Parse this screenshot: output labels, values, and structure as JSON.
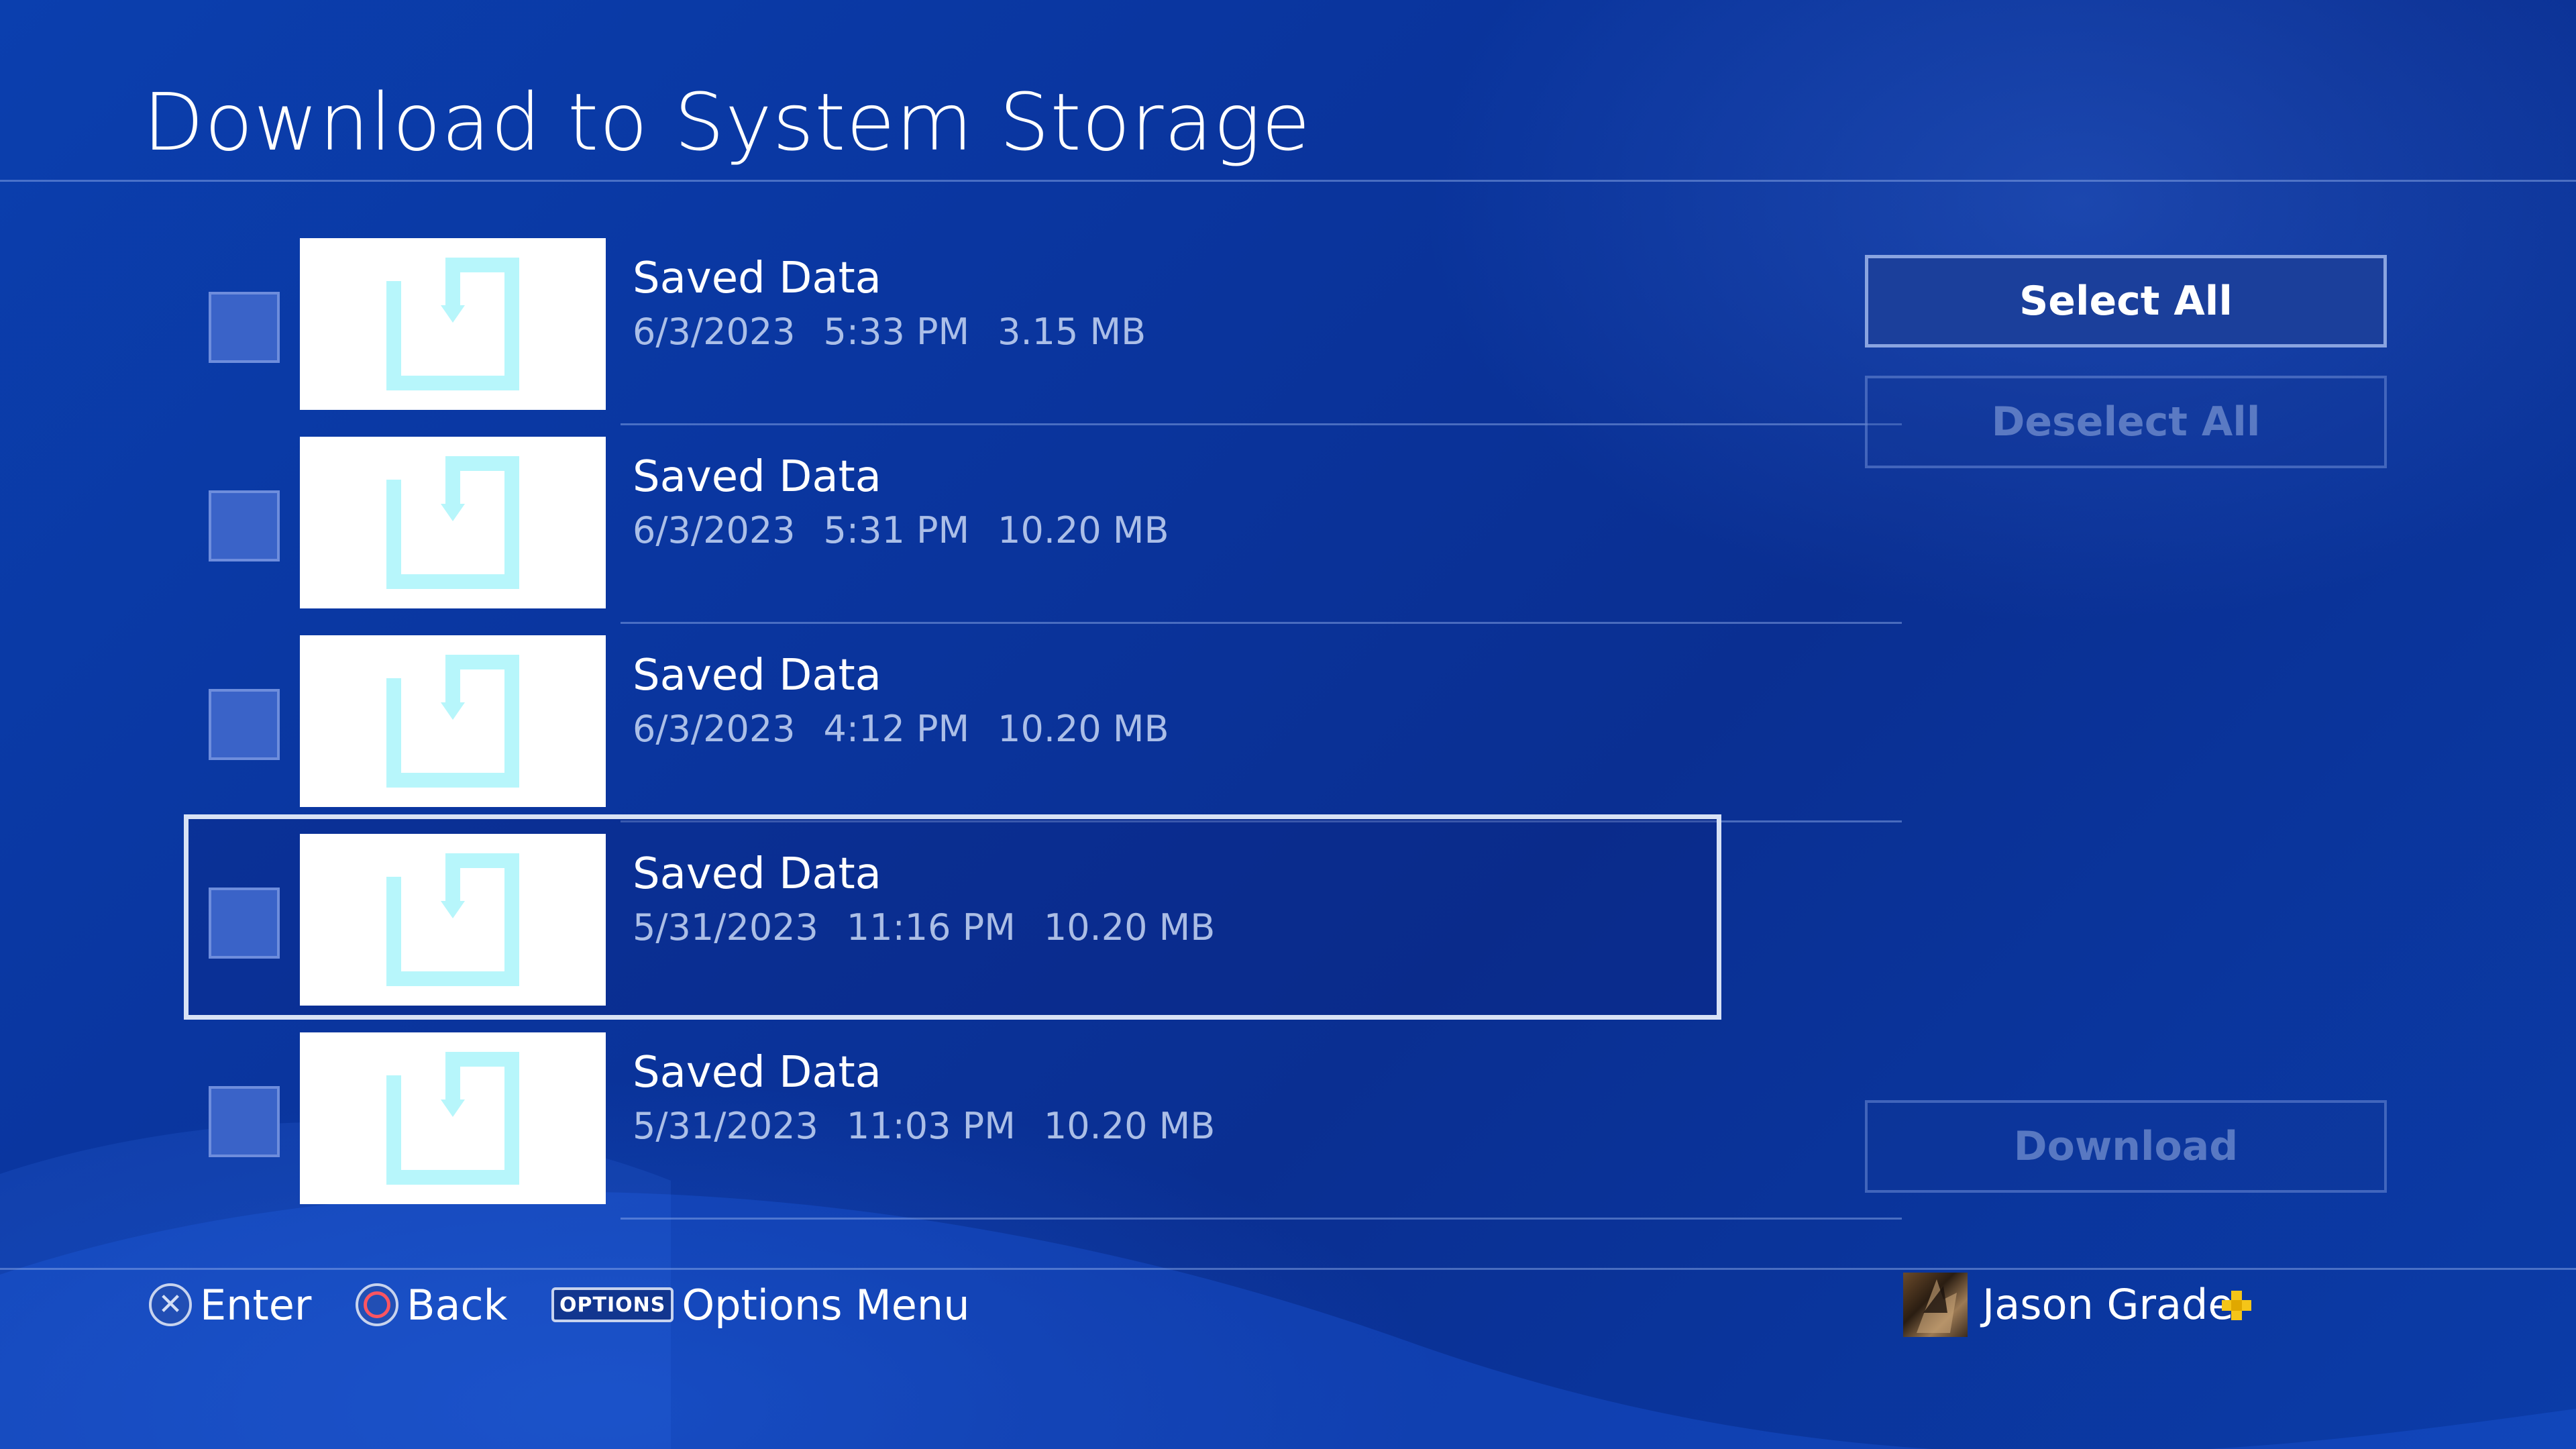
{
  "header": {
    "title": "Download to System Storage"
  },
  "saved_data_list": [
    {
      "name": "Saved Data",
      "date": "6/3/2023",
      "time": "5:33 PM",
      "size": "3.15 MB",
      "checked": false,
      "focused": false
    },
    {
      "name": "Saved Data",
      "date": "6/3/2023",
      "time": "5:31 PM",
      "size": "10.20 MB",
      "checked": false,
      "focused": false
    },
    {
      "name": "Saved Data",
      "date": "6/3/2023",
      "time": "4:12 PM",
      "size": "10.20 MB",
      "checked": false,
      "focused": false
    },
    {
      "name": "Saved Data",
      "date": "5/31/2023",
      "time": "11:16 PM",
      "size": "10.20 MB",
      "checked": false,
      "focused": true
    },
    {
      "name": "Saved Data",
      "date": "5/31/2023",
      "time": "11:03 PM",
      "size": "10.20 MB",
      "checked": false,
      "focused": false
    }
  ],
  "actions": {
    "select_all": "Select All",
    "deselect_all": "Deselect All",
    "download": "Download"
  },
  "footer": {
    "enter_label": "Enter",
    "back_label": "Back",
    "options_key": "OPTIONS",
    "options_label": "Options Menu",
    "user_name": "Jason Grade"
  },
  "icons": {
    "thumbnail": "download-arrow-icon",
    "cross": "cross-button-icon",
    "circle": "circle-button-icon",
    "plus": "ps-plus-icon"
  },
  "colors": {
    "background": "#0a36a0",
    "thumbnail_icon": "#b7f6fb",
    "plus_gold": "#f5c518",
    "circle_red": "#ff5561"
  }
}
